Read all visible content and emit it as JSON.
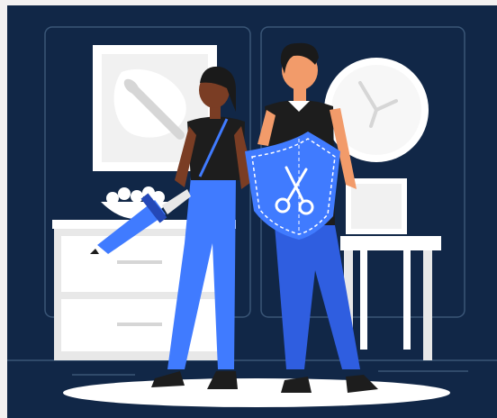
{
  "scene": {
    "subject": "two-people-with-pencil-sword-and-scissors-shield",
    "colors": {
      "frame": "#f3f1f1",
      "background": "#112747",
      "panel_outline": "#3a5677",
      "white": "#ffffff",
      "light_gray": "#e8e8e8",
      "accent_blue": "#407bff",
      "mid_blue": "#2f5ee0",
      "dark_blue": "#2448b7",
      "shirt": "#1d1d1d",
      "skin_dark": "#7a3d24",
      "skin_light": "#f29b6a",
      "hair": "#1a1a1a",
      "floor_line": "#3a5677"
    },
    "icons": [
      "paintbrush-icon",
      "scissors-icon",
      "clock-icon"
    ]
  }
}
